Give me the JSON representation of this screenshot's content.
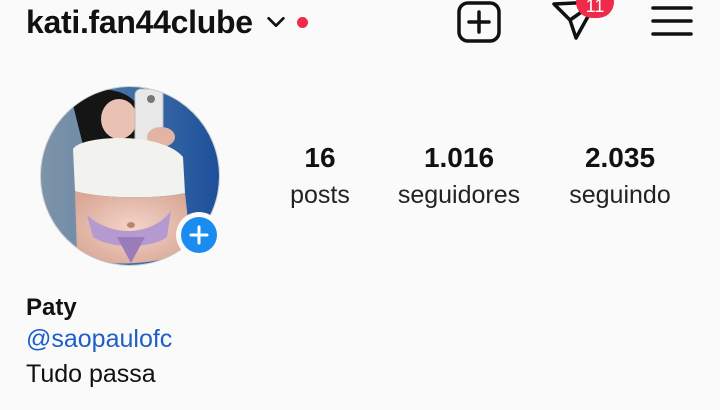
{
  "header": {
    "username": "kati.fan44clube",
    "dm_badge": "11",
    "icons": [
      "chevron-down-icon",
      "new-post-icon",
      "direct-message-icon",
      "menu-icon"
    ],
    "notification_dot_color": "#ef2b4a"
  },
  "profile": {
    "stats": [
      {
        "value": "16",
        "label": "posts"
      },
      {
        "value": "1.016",
        "label": "seguidores"
      },
      {
        "value": "2.035",
        "label": "seguindo"
      }
    ],
    "name": "Paty",
    "link": "@saopaulofc",
    "bio": "Tudo passa"
  },
  "colors": {
    "accent": "#1a8cf0",
    "link": "#1e5fc7",
    "badge": "#ef2b4a",
    "background": "#fafafa"
  }
}
